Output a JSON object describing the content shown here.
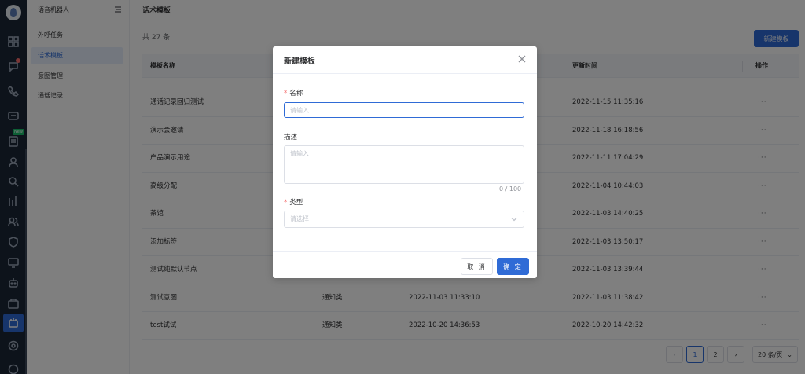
{
  "rail": {
    "icons": [
      "app-logo",
      "dashboard-icon",
      "chat-icon",
      "phone-icon",
      "message-icon",
      "document-icon",
      "user-icon",
      "search-user-icon",
      "chart-icon",
      "team-icon",
      "shield-icon",
      "monitor-icon",
      "robot-icon",
      "box-icon",
      "voice-robot-icon",
      "settings-icon",
      "help-icon"
    ],
    "new_badge": "New",
    "active_color": "#2f6bd6"
  },
  "submenu": {
    "title": "语音机器人",
    "items": [
      {
        "label": "外呼任务",
        "active": false
      },
      {
        "label": "话术模板",
        "active": true
      },
      {
        "label": "意图管理",
        "active": false
      },
      {
        "label": "通话记录",
        "active": false
      }
    ]
  },
  "main": {
    "title": "话术模板",
    "total": "共 27 条",
    "new_button": "新建模板",
    "columns": [
      "模板名称",
      "更新时间",
      "操作"
    ],
    "rows": [
      {
        "name": "通话记录回归测试",
        "type": "",
        "created": "",
        "updated": "2022-11-15 11:35:16",
        "action": "···"
      },
      {
        "name": "演示会邀请",
        "type": "",
        "created": "",
        "updated": "2022-11-18 16:18:56",
        "action": "···"
      },
      {
        "name": "产品演示用途",
        "type": "",
        "created": "",
        "updated": "2022-11-11 17:04:29",
        "action": "···"
      },
      {
        "name": "高级分配",
        "type": "",
        "created": "",
        "updated": "2022-11-04 10:44:03",
        "action": "···"
      },
      {
        "name": "茶馆",
        "type": "",
        "created": "",
        "updated": "2022-11-03 14:40:25",
        "action": "···"
      },
      {
        "name": "添加标签",
        "type": "",
        "created": "",
        "updated": "2022-11-03 13:50:17",
        "action": "···"
      },
      {
        "name": "测试纯默认节点",
        "type": "",
        "created": "",
        "updated": "2022-11-03 13:39:44",
        "action": "···"
      },
      {
        "name": "测试意图",
        "type": "通知类",
        "created": "2022-11-03 11:33:10",
        "updated": "2022-11-03 11:38:42",
        "action": "···"
      },
      {
        "name": "test试试",
        "type": "通知类",
        "created": "2022-10-20 14:36:53",
        "updated": "2022-10-20 14:42:32",
        "action": "···"
      }
    ],
    "pagination": {
      "prev": "‹",
      "pages": [
        "1",
        "2"
      ],
      "current": "1",
      "next": "›",
      "page_size": "20 条/页"
    }
  },
  "dialog": {
    "title": "新建模板",
    "name_label": "名称",
    "name_placeholder": "请输入",
    "desc_label": "描述",
    "desc_placeholder": "请输入",
    "desc_counter": "0 / 100",
    "type_label": "类型",
    "type_placeholder": "请选择",
    "required_mark": "*",
    "cancel": "取 消",
    "confirm": "确 定"
  }
}
